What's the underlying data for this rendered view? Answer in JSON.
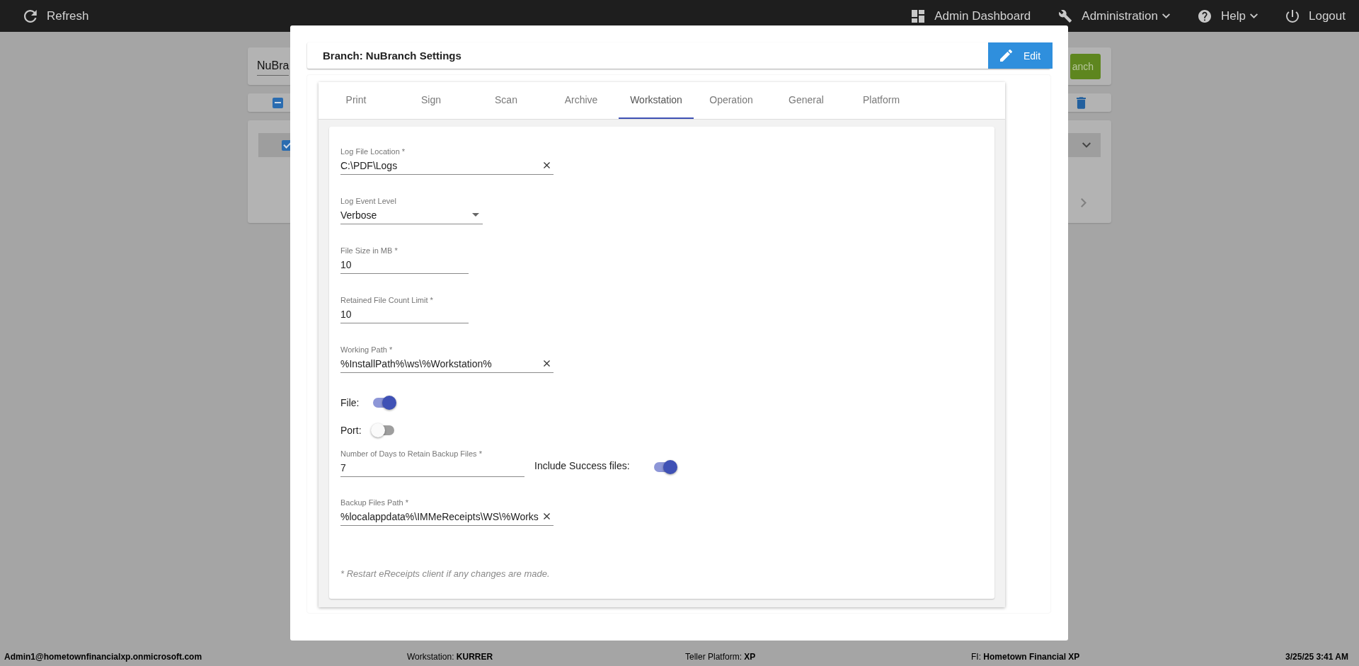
{
  "top_bar": {
    "left": [
      {
        "kind": "refresh",
        "label": "Refresh"
      }
    ],
    "right": [
      {
        "kind": "dashboard",
        "label": "Admin Dashboard",
        "dropdown": false
      },
      {
        "kind": "wrench",
        "label": "Administration",
        "dropdown": true
      },
      {
        "kind": "help",
        "label": "Help",
        "dropdown": true
      },
      {
        "kind": "power",
        "label": "Logout",
        "dropdown": false
      }
    ]
  },
  "background": {
    "branch_field": {
      "value": "NuBra"
    },
    "add_button": {
      "label": "anch"
    },
    "select_all": {
      "indeterminate": true
    },
    "row": {
      "checked": true
    }
  },
  "modal": {
    "title": "Branch: NuBranch Settings",
    "edit_button": "Edit",
    "tabs": [
      {
        "label": "Print",
        "selected": false
      },
      {
        "label": "Sign",
        "selected": false
      },
      {
        "label": "Scan",
        "selected": false
      },
      {
        "label": "Archive",
        "selected": false
      },
      {
        "label": "Workstation",
        "selected": true
      },
      {
        "label": "Operation",
        "selected": false
      },
      {
        "label": "General",
        "selected": false
      },
      {
        "label": "Platform",
        "selected": false
      }
    ],
    "fields": [
      {
        "kind": "text",
        "label": "Log File Location *",
        "value": "C:\\PDF\\Logs",
        "clearable": true
      },
      {
        "kind": "select",
        "label": "Log Event Level",
        "value": "Verbose"
      },
      {
        "kind": "text",
        "label": "File Size in MB *",
        "value": "10",
        "clearable": false
      },
      {
        "kind": "text",
        "label": "Retained File Count Limit *",
        "value": "10",
        "clearable": false
      },
      {
        "kind": "text",
        "label": "Working Path *",
        "value": "%InstallPath%\\ws\\%Workstation%",
        "clearable": true
      },
      {
        "kind": "toggle",
        "label": "File:",
        "on": true
      },
      {
        "kind": "toggle",
        "label": "Port:",
        "on": false
      },
      {
        "kind": "text_with_toggle",
        "label": "Number of Days to Retain Backup Files *",
        "value": "7",
        "clearable": false,
        "toggle": {
          "label": "Include Success files:",
          "on": true
        }
      },
      {
        "kind": "text",
        "label": "Backup Files Path *",
        "value": "%localappdata%\\IMMeReceipts\\WS\\%Works",
        "clearable": true
      }
    ],
    "footnote": "* Restart eReceipts client if any changes are made."
  },
  "status_bar": [
    {
      "kind": "user",
      "text": "Admin1@hometownfinancialxp.onmicrosoft.com"
    },
    {
      "kind": "workstation",
      "text": "Workstation: **KURRER**"
    },
    {
      "kind": "platform",
      "text": "Teller Platform: **XP**"
    },
    {
      "kind": "fi",
      "text": "FI: **Hometown Financial XP**"
    },
    {
      "kind": "datetime",
      "text": "3/25/25 3:41 AM"
    }
  ]
}
